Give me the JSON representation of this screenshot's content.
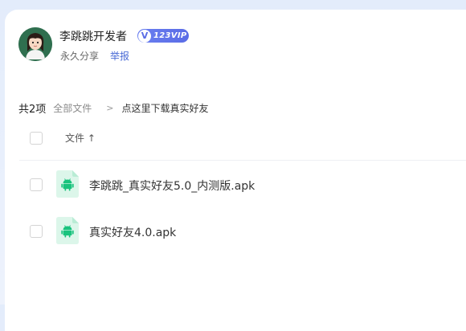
{
  "sharer": {
    "name": "李跳跳开发者",
    "badge_text": "123VIP",
    "badge_icon": "V",
    "share_type": "永久分享",
    "report_label": "举报"
  },
  "breadcrumb": {
    "count": "共2项",
    "root": "全部文件",
    "separator": ">",
    "current": "点这里下载真实好友"
  },
  "table": {
    "header_label": "文件 ↑",
    "files": [
      {
        "name": "李跳跳_真实好友5.0_内测版.apk",
        "icon": "android-icon"
      },
      {
        "name": "真实好友4.0.apk",
        "icon": "android-icon"
      }
    ]
  },
  "colors": {
    "accent": "#4a6bd6",
    "vip_badge": "#5a6ce6",
    "apk_icon": "#19c37d",
    "avatar_bg": "#2f6f4f"
  }
}
